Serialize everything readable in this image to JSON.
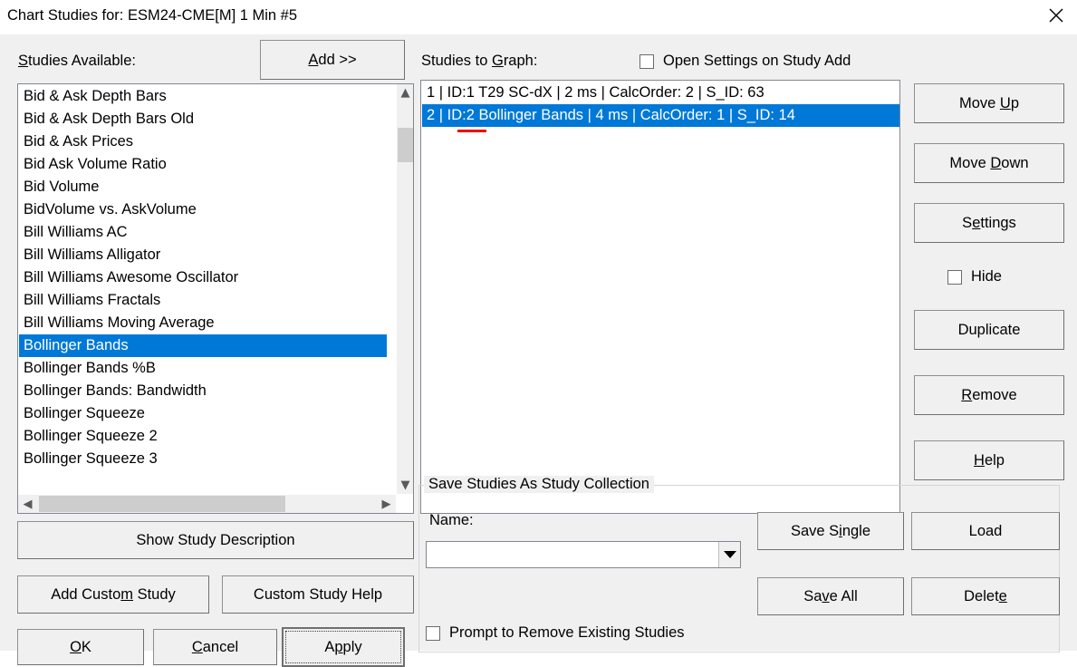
{
  "window": {
    "title": "Chart Studies for: ESM24-CME[M]  1 Min  #5",
    "close_icon": "close-icon"
  },
  "colors": {
    "dialog_bg": "#f0f0f0",
    "selection_blue": "#0078d7",
    "annotation_red": "#ee0000",
    "field_bg": "#ffffff",
    "scroll_thumb": "#cdcdcd"
  },
  "left_panel": {
    "available_label": "Studies Available:",
    "available_label_accel": "S",
    "add_button": "Add >>",
    "add_button_accel": "A",
    "selected_index": 11,
    "available_items": [
      "Bid & Ask Depth Bars",
      "Bid & Ask Depth Bars Old",
      "Bid & Ask Prices",
      "Bid Ask Volume Ratio",
      "Bid Volume",
      "BidVolume vs. AskVolume",
      "Bill Williams AC",
      "Bill Williams Alligator",
      "Bill Williams Awesome Oscillator",
      "Bill Williams Fractals",
      "Bill Williams Moving Average",
      "Bollinger Bands",
      "Bollinger Bands %B",
      "Bollinger Bands: Bandwidth",
      "Bollinger Squeeze",
      "Bollinger Squeeze 2",
      "Bollinger Squeeze 3"
    ],
    "show_description_button": "Show Study Description",
    "add_custom_study_button": "Add Custom Study",
    "add_custom_study_accel": "m",
    "custom_study_help_button": "Custom Study Help",
    "ok_button": "OK",
    "ok_accel": "O",
    "cancel_button": "Cancel",
    "cancel_accel": "C",
    "apply_button": "Apply",
    "apply_accel": "p",
    "apply_is_default": true
  },
  "graph_panel": {
    "label": "Studies to Graph:",
    "label_accel": "G",
    "open_settings_checkbox": {
      "label": "Open Settings on Study Add",
      "checked": false
    },
    "selected_index": 1,
    "rows": [
      {
        "order": "1",
        "id": "ID:1",
        "name": "T29 SC-dX",
        "time": "2 ms",
        "calc_order": "CalcOrder: 2",
        "s_id": "S_ID: 63",
        "text": "1 | ID:1  T29 SC-dX | 2 ms | CalcOrder: 2 | S_ID: 63",
        "annotated": false
      },
      {
        "order": "2",
        "id": "ID:2",
        "name": "Bollinger Bands",
        "time": "4 ms",
        "calc_order": "CalcOrder: 1",
        "s_id": "S_ID: 14",
        "text": "2 | ID:2  Bollinger Bands | 4 ms | CalcOrder: 1 | S_ID: 14",
        "annotated": true
      }
    ]
  },
  "right_buttons": {
    "move_up": "Move Up",
    "move_up_accel": "U",
    "move_down": "Move Down",
    "move_down_accel": "D",
    "settings": "Settings",
    "settings_accel": "e",
    "hide_checkbox": {
      "label": "Hide",
      "checked": false
    },
    "duplicate": "Duplicate",
    "remove": "Remove",
    "remove_accel": "R",
    "help": "Help",
    "help_accel": "H"
  },
  "collection_group": {
    "title": "Save Studies As Study Collection",
    "name_label": "Name:",
    "name_value": "",
    "name_placeholder": "",
    "dropdown_icon": "chevron-down-icon",
    "prompt_checkbox": {
      "label": "Prompt to Remove Existing Studies",
      "checked": false
    },
    "save_single": "Save Single",
    "save_single_accel": "i",
    "load": "Load",
    "save_all": "Save All",
    "save_all_accel": "v",
    "delete": "Delete",
    "delete_accel": "e"
  }
}
